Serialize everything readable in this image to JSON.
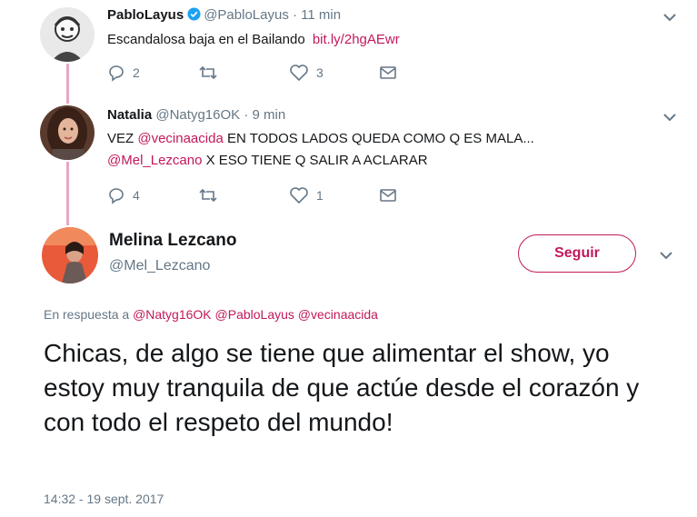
{
  "tweet1": {
    "name": "PabloLayus",
    "handle": "@PabloLayus",
    "sep": "·",
    "time": "11 min",
    "text": "Escandalosa baja en el Bailando",
    "link": "bit.ly/2hgAEwr",
    "replies": "2",
    "retweets": "",
    "likes": "3"
  },
  "tweet2": {
    "name": "Natalia",
    "handle": "@Natyg16OK",
    "sep": "·",
    "time": "9 min",
    "line1_prefix": "VEZ ",
    "line1_mention": "@vecinaacida",
    "line1_suffix": " EN TODOS LADOS QUEDA COMO Q ES MALA...",
    "line2_mention": "@Mel_Lezcano",
    "line2_suffix": " X ESO TIENE Q SALIR A ACLARAR",
    "replies": "4",
    "retweets": "",
    "likes": "1"
  },
  "main": {
    "name": "Melina Lezcano",
    "handle": "@Mel_Lezcano",
    "follow_label": "Seguir",
    "reply_prefix": "En respuesta a",
    "reply_mentions": "@Natyg16OK @PabloLayus @vecinaacida",
    "text": "Chicas, de algo se tiene que alimentar el show, yo estoy muy tranquila de que actúe desde el corazón y con todo el respeto del mundo!",
    "timestamp": "14:32 - 19 sept. 2017"
  },
  "colors": {
    "accent": "#c2185b",
    "thread_line": "#e8a6c8",
    "muted": "#657786",
    "verified": "#1da1f2"
  },
  "icons": [
    "reply-icon",
    "retweet-icon",
    "like-icon",
    "message-icon",
    "chevron-down-icon",
    "verified-icon"
  ]
}
